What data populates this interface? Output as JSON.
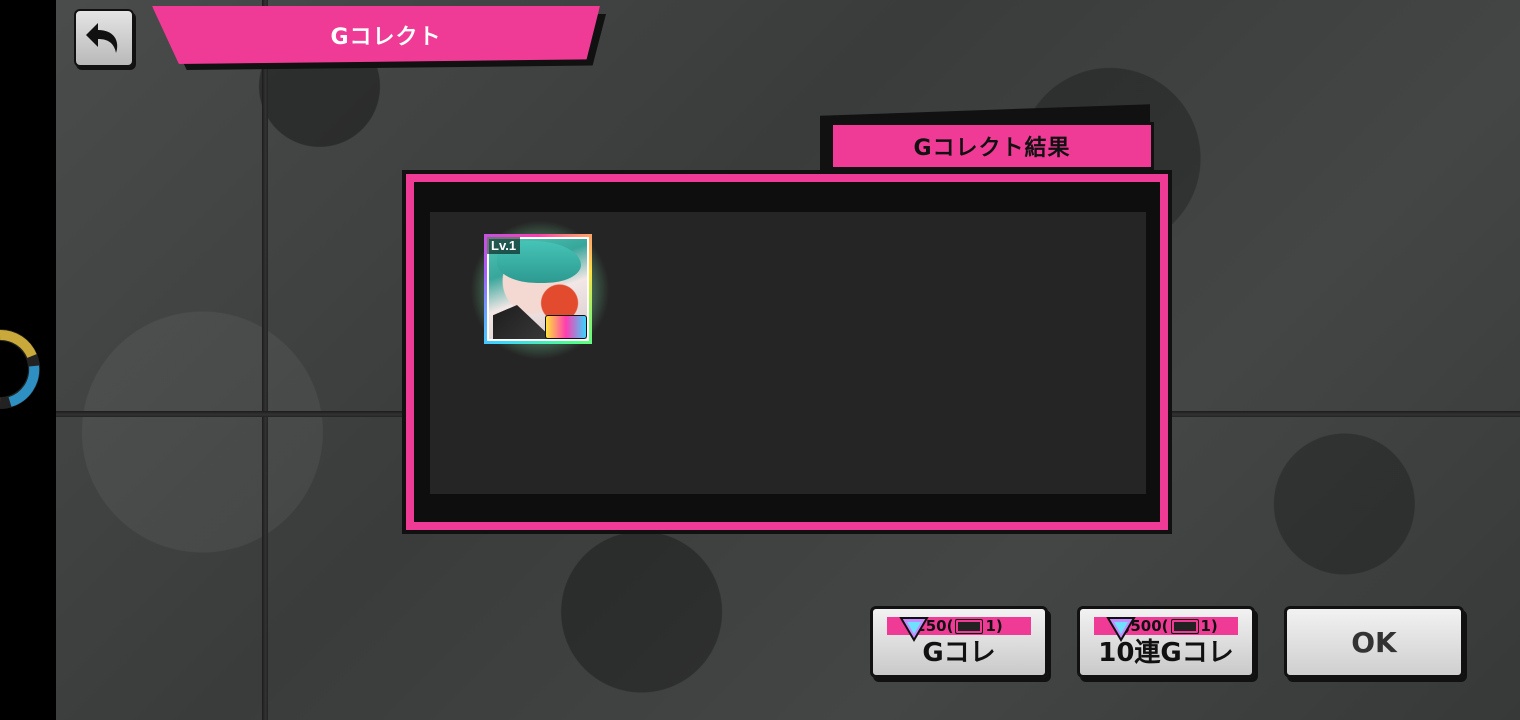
{
  "header": {
    "title": "Gコレクト"
  },
  "back_button": {
    "icon": "back-arrow-icon"
  },
  "result_panel": {
    "title": "Gコレクト結果",
    "items": [
      {
        "level": "Lv.1",
        "badge": "rainbow-rarity-badge"
      }
    ]
  },
  "buttons": {
    "single": {
      "cost": "250(",
      "tickets": "1)",
      "label": "Gコレ"
    },
    "ten": {
      "cost": "2,500(",
      "tickets": "1)",
      "label": "10連Gコレ"
    },
    "ok": {
      "label": "OK"
    }
  },
  "colors": {
    "accent": "#ef3b96",
    "panel_bg": "#252525",
    "button_bg": "#e4e4e4"
  }
}
